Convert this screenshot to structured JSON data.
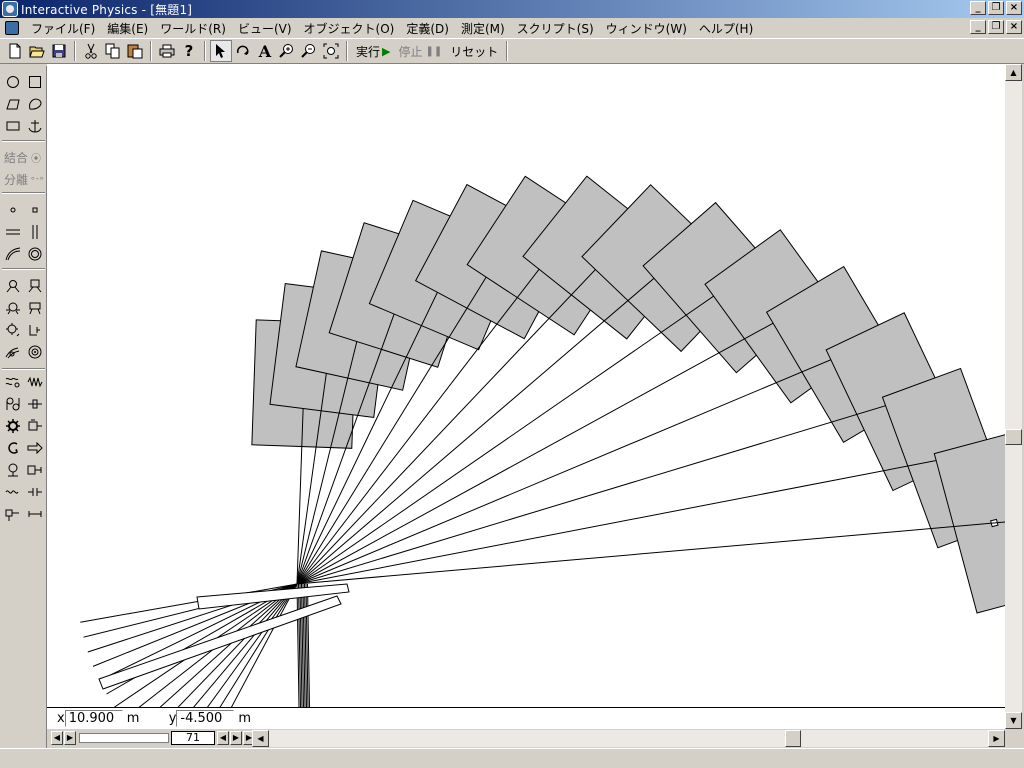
{
  "window": {
    "title": "Interactive Physics - [無題1]",
    "minimize": "_",
    "restore": "❐",
    "close": "×"
  },
  "menu": {
    "items": [
      {
        "label": "ファイル(F)"
      },
      {
        "label": "編集(E)"
      },
      {
        "label": "ワールド(R)"
      },
      {
        "label": "ビュー(V)"
      },
      {
        "label": "オブジェクト(O)"
      },
      {
        "label": "定義(D)"
      },
      {
        "label": "測定(M)"
      },
      {
        "label": "スクリプト(S)"
      },
      {
        "label": "ウィンドウ(W)"
      },
      {
        "label": "ヘルプ(H)"
      }
    ]
  },
  "toolbar": {
    "run_label": "実行",
    "stop_label": "停止",
    "reset_label": "リセット",
    "text_tool_glyph": "A",
    "help_glyph": "?"
  },
  "palette": {
    "join_label": "結合",
    "split_label": "分離"
  },
  "coords": {
    "x_label": "x",
    "x_value": "10.900",
    "x_unit": "m",
    "y_label": "y",
    "y_value": "-4.500",
    "y_unit": "m"
  },
  "playback": {
    "frame": "71"
  },
  "colors": {
    "title_bar_start": "#0a246a",
    "title_bar_end": "#a6caf0",
    "chrome": "#d4d0c8",
    "body_fill": "#c0c0c0",
    "canvas": "#ffffff"
  }
}
